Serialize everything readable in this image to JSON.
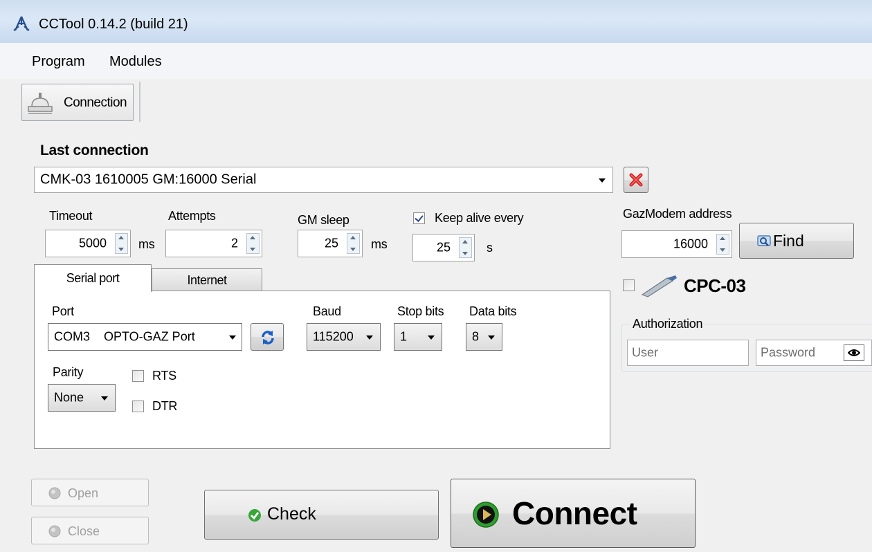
{
  "window": {
    "title": "CCTool 0.14.2 (build 21)"
  },
  "menu": {
    "items": [
      "Program",
      "Modules"
    ]
  },
  "toolbar": {
    "connection_label": "Connection"
  },
  "last_connection": {
    "heading": "Last connection",
    "selected": "CMK-03 1610005 GM:16000 Serial"
  },
  "settings": {
    "timeout": {
      "label": "Timeout",
      "value": "5000",
      "unit": "ms"
    },
    "attempts": {
      "label": "Attempts",
      "value": "2"
    },
    "gm_sleep": {
      "label": "GM sleep",
      "value": "25",
      "unit": "ms"
    },
    "keep_alive": {
      "label": "Keep alive every",
      "checked": true,
      "value": "25",
      "unit": "s"
    }
  },
  "gazmodem": {
    "label": "GazModem address",
    "value": "16000",
    "find_label": "Find"
  },
  "cpc": {
    "label": "CPC-03",
    "checked": false
  },
  "authorization": {
    "title": "Authorization",
    "user_placeholder": "User",
    "password_placeholder": "Password"
  },
  "tabs": [
    {
      "label": "Serial port",
      "active": true
    },
    {
      "label": "Internet",
      "active": false
    }
  ],
  "serial": {
    "port": {
      "label": "Port",
      "value": "COM3    OPTO-GAZ Port"
    },
    "baud": {
      "label": "Baud",
      "value": "115200"
    },
    "stop_bits": {
      "label": "Stop bits",
      "value": "1"
    },
    "data_bits": {
      "label": "Data bits",
      "value": "8"
    },
    "parity": {
      "label": "Parity",
      "value": "None"
    },
    "rts": {
      "label": "RTS",
      "checked": false
    },
    "dtr": {
      "label": "DTR",
      "checked": false
    }
  },
  "actions": {
    "open": "Open",
    "close": "Close",
    "check": "Check",
    "connect": "Connect"
  },
  "colors": {
    "titlebar": "#cfdff0",
    "accent_green": "#2e9e2e",
    "delete_red": "#d62020"
  }
}
